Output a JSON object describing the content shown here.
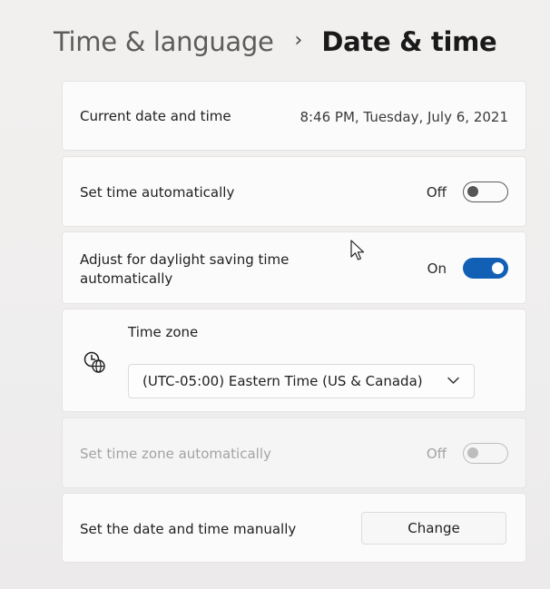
{
  "breadcrumb": {
    "parent": "Time & language",
    "separator": "›",
    "current": "Date & time"
  },
  "current_datetime": {
    "label": "Current date and time",
    "value": "8:46 PM, Tuesday, July 6, 2021"
  },
  "set_time_auto": {
    "label": "Set time automatically",
    "state_label": "Off",
    "enabled": false
  },
  "daylight_saving": {
    "label_line1": "Adjust for daylight saving time",
    "label_line2": "automatically",
    "state_label": "On",
    "enabled": true
  },
  "time_zone": {
    "label": "Time zone",
    "selected": "(UTC-05:00) Eastern Time (US & Canada)",
    "icon": "globe-clock-icon"
  },
  "set_time_zone_auto": {
    "label": "Set time zone automatically",
    "state_label": "Off",
    "enabled": false,
    "disabled": true
  },
  "manual_datetime": {
    "label": "Set the date and time manually",
    "button_label": "Change"
  },
  "colors": {
    "accent": "#1160b6",
    "card_background": "#fbfbfb",
    "disabled_text": "#a3a3a3"
  }
}
